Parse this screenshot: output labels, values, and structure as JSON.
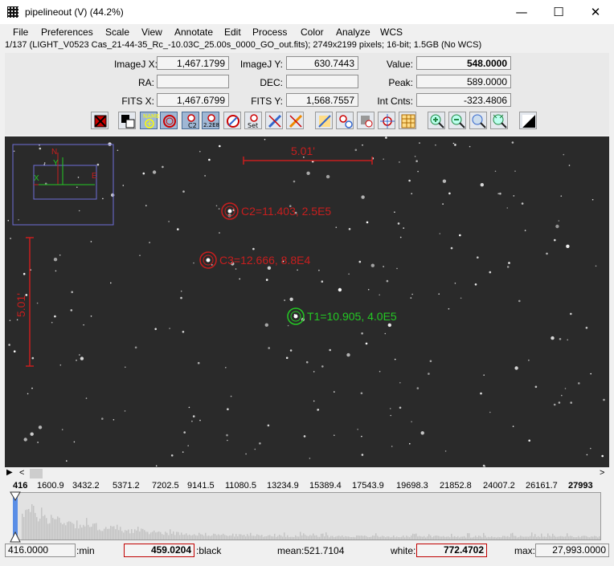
{
  "window": {
    "title": "pipelineout (V) (44.2%)",
    "minimize": "—",
    "maximize": "☐",
    "close": "✕"
  },
  "menu": [
    "File",
    "Preferences",
    "Scale",
    "View",
    "Annotate",
    "Edit",
    "Process",
    "Color",
    "Analyze",
    "WCS"
  ],
  "info_line": "1/137 (LIGHT_V0523 Cas_21-44-35_Rc_-10.03C_25.00s_0000_GO_out.fits); 2749x2199 pixels; 16-bit; 1.5GB (No WCS)",
  "coords": {
    "imagej_x_label": "ImageJ X:",
    "imagej_x": "1,467.1799",
    "imagej_y_label": "ImageJ Y:",
    "imagej_y": "630.7443",
    "value_label": "Value:",
    "value": "548.0000",
    "ra_label": "RA:",
    "ra": "",
    "dec_label": "DEC:",
    "dec": "",
    "peak_label": "Peak:",
    "peak": "589.0000",
    "fits_x_label": "FITS X:",
    "fits_x": "1,467.6799",
    "fits_y_label": "FITS Y:",
    "fits_y": "1,568.7557",
    "intcnts_label": "Int Cnts:",
    "intcnts": "-323.4806"
  },
  "toolbar": {
    "name_label": "NAME",
    "c2_label": "C2",
    "scale_label": "2.2E8",
    "set_label": "Set"
  },
  "image": {
    "scale_h": "5.01'",
    "scale_v": "5.01'",
    "compass_n": "N",
    "compass_e": "E",
    "compass_x": "X",
    "compass_y": "Y",
    "annotations": [
      {
        "label": "C2=11.403, 2.5E5",
        "color": "#c81e1e"
      },
      {
        "label": "C3=12.666, 8.8E4",
        "color": "#c81e1e"
      },
      {
        "label": "T1=10.905, 4.0E5",
        "color": "#24c824"
      }
    ]
  },
  "histogram": {
    "ticks": [
      "416",
      "1600.9",
      "3432.2",
      "5371.2",
      "7202.5",
      "9141.5",
      "11080.5",
      "13234.9",
      "15389.4",
      "17543.9",
      "19698.3",
      "21852.8",
      "24007.2",
      "26161.7",
      "27993"
    ]
  },
  "stats": {
    "min_value": "416.0000",
    "min_label": ":min",
    "black_value": "459.0204",
    "black_label": ":black",
    "mean_text": "mean:521.7104",
    "white_label": "white:",
    "white_value": "772.4702",
    "max_label": "max:",
    "max_value": "27,993.0000"
  },
  "colors": {
    "target": "#24c824",
    "comp": "#c81e1e",
    "overlay": "#6d6dd8"
  }
}
